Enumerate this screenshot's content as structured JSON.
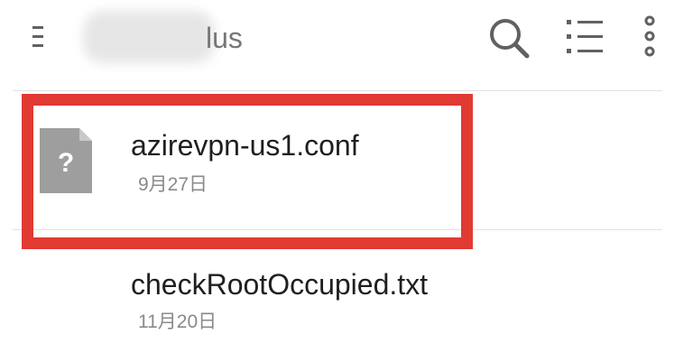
{
  "toolbar": {
    "title_visible": "lus",
    "icons": {
      "menu": "menu-lines-icon",
      "search": "search-icon",
      "view": "list-view-icon",
      "more": "more-vertical-icon"
    }
  },
  "files": [
    {
      "name": "azirevpn-us1.conf",
      "date": "9月27日",
      "icon": "unknown-file-icon",
      "icon_glyph": "?"
    },
    {
      "name": "checkRootOccupied.txt",
      "date": "11月20日"
    }
  ],
  "colors": {
    "highlight": "#e03a33",
    "file_icon": "#9e9e9e",
    "toolbar_icon": "#616161"
  }
}
